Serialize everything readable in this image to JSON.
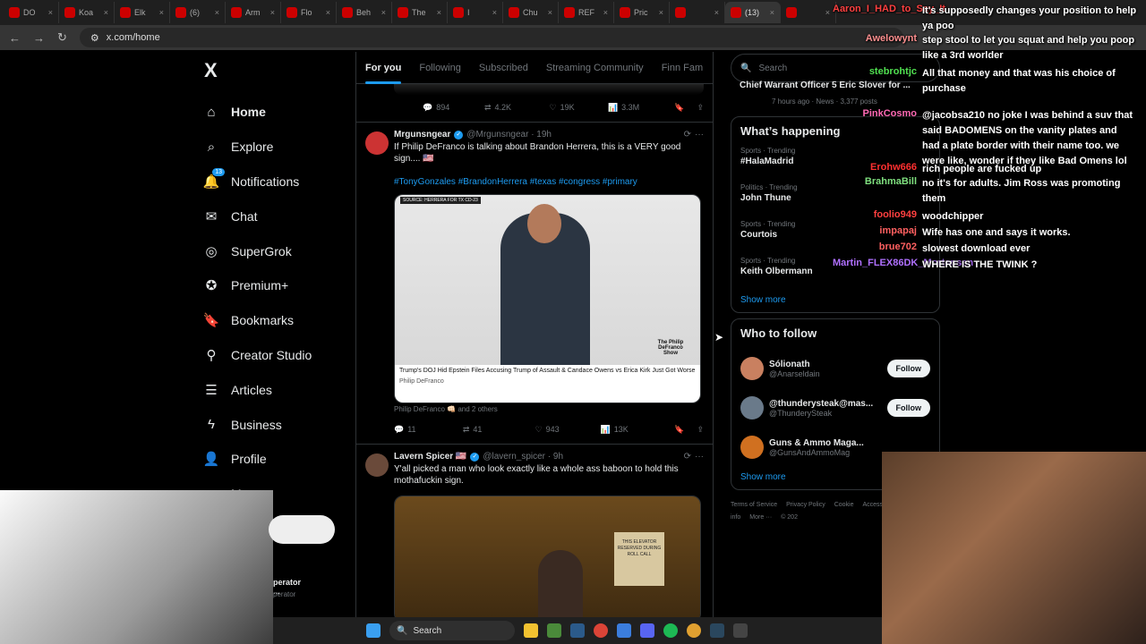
{
  "browser": {
    "tabs": [
      "DO",
      "Koa",
      "Elk",
      "(6)",
      "Arm",
      "Flo",
      "Beh",
      "The",
      "I",
      "Chu",
      "REF",
      "Pric",
      "",
      "(13)",
      ""
    ],
    "url": "x.com/home"
  },
  "x": {
    "logo": "X",
    "nav": [
      {
        "label": "Home",
        "icon": "home-icon"
      },
      {
        "label": "Explore",
        "icon": "search-icon"
      },
      {
        "label": "Notifications",
        "icon": "bell-icon",
        "badge": "13"
      },
      {
        "label": "Chat",
        "icon": "mail-icon"
      },
      {
        "label": "SuperGrok",
        "icon": "grok-icon"
      },
      {
        "label": "Premium+",
        "icon": "premium-icon"
      },
      {
        "label": "Bookmarks",
        "icon": "bookmark-icon"
      },
      {
        "label": "Creator Studio",
        "icon": "creator-icon"
      },
      {
        "label": "Articles",
        "icon": "articles-icon"
      },
      {
        "label": "Business",
        "icon": "bolt-icon"
      },
      {
        "label": "Profile",
        "icon": "person-icon"
      },
      {
        "label": "More",
        "icon": "more-icon"
      }
    ],
    "feed_tabs": [
      "For you",
      "Following",
      "Subscribed",
      "Streaming Community",
      "Finn Fam"
    ],
    "top_actions": {
      "replies": "894",
      "reposts": "4.2K",
      "likes": "19K",
      "views": "3.3M"
    },
    "posts": [
      {
        "name": "Mrgunsngear",
        "handle": "@Mrgunsngear · 19h",
        "text": "If Philip DeFranco is talking about Brandon Herrera, this is a VERY good sign.... 🇺🇸",
        "hashtags": "#TonyGonzales #BrandonHerrera #texas #congress #primary",
        "media_source": "SOURCE: HERRERA FOR TX CD-23",
        "media_caption": "Trump's DOJ Hid Epstein Files Accusing Trump of Assault & Candace Owens vs Erica Kirk Just Got Worse",
        "media_channel": "Philip DeFranco",
        "media_logo": "The Philip DeFranco Show",
        "reposted_by": "Philip DeFranco 👊🏻 and 2 others",
        "replies": "11",
        "reposts": "41",
        "likes": "943",
        "views": "13K"
      },
      {
        "name": "Lavern Spicer 🇺🇸",
        "handle": "@lavern_spicer · 9h",
        "text": "Y'all picked a man who look exactly like a whole ass baboon to hold this mothafuckin sign.",
        "sign_text": "THIS ELEVATOR RESERVED DURING ROLL CALL"
      }
    ],
    "search_placeholder": "Search",
    "top_news": {
      "title": "Chief Warrant Officer 5 Eric Slover for ...",
      "meta": "7 hours ago · News · 3,377 posts"
    },
    "whats_happening": {
      "title": "What’s happening",
      "trends": [
        {
          "cat": "Sports · Trending",
          "name": "#HalaMadrid"
        },
        {
          "cat": "Politics · Trending",
          "name": "John Thune"
        },
        {
          "cat": "Sports · Trending",
          "name": "Courtois"
        },
        {
          "cat": "Sports · Trending",
          "name": "Keith Olbermann"
        }
      ],
      "show_more": "Show more"
    },
    "who_to_follow": {
      "title": "Who to follow",
      "accounts": [
        {
          "name": "Sólionath",
          "handle": "@Anarseldain",
          "button": "Follow"
        },
        {
          "name": "@thunderysteak@mas...",
          "handle": "@ThunderySteak",
          "button": "Follow"
        },
        {
          "name": "Guns & Ammo Maga...",
          "handle": "@GunsAndAmmoMag",
          "button": ""
        }
      ],
      "show_more": "Show more"
    },
    "footer": [
      "Terms of Service",
      "Privacy Policy",
      "Cookie",
      "Accessibility",
      "Ads info",
      "More ···",
      "© 202"
    ],
    "account": {
      "name": "perator ...",
      "handle": "perator"
    }
  },
  "chat": [
    {
      "user": "Aaron_I_HAD_to_Say_It",
      "text": "It's supposedly changes your position to help ya poo",
      "color": "#ff4040"
    },
    {
      "user": "Awelowynt",
      "text": "step stool to let you squat and help you poop like a 3rd worlder",
      "color": "#ff9090"
    },
    {
      "user": "stebrohtjc",
      "text": "All that money and that was his choice of purchase",
      "color": "#50e050"
    },
    {
      "user": "PinkCosmo",
      "text": "@jacobsa210 no joke I was behind a suv that said BADOMENS on the vanity plates and had a plate border with their name too. we were like, wonder if they like Bad Omens lol",
      "color": "#ff69b4"
    },
    {
      "user": "Erohw666",
      "text": "rich people are fucked up",
      "color": "#ff3030"
    },
    {
      "user": "BrahmaBill",
      "text": "no it's for adults. Jim Ross was promoting them",
      "color": "#7fe07f"
    },
    {
      "user": "foolio949",
      "text": "woodchipper",
      "color": "#ff4040"
    },
    {
      "user": "impapaj",
      "text": "Wife has one and says it works.",
      "color": "#ff6060"
    },
    {
      "user": "brue702",
      "text": "slowest download ever",
      "color": "#ff6060"
    },
    {
      "user": "Martin_FLEX86DK_Mortensen",
      "text": "WHERE IS THE TWINK ?",
      "color": "#b070ff"
    }
  ],
  "taskbar": {
    "search": "Search"
  },
  "colors": {
    "accent": "#1d9bf0",
    "background": "#000000",
    "border": "#2f3336"
  }
}
